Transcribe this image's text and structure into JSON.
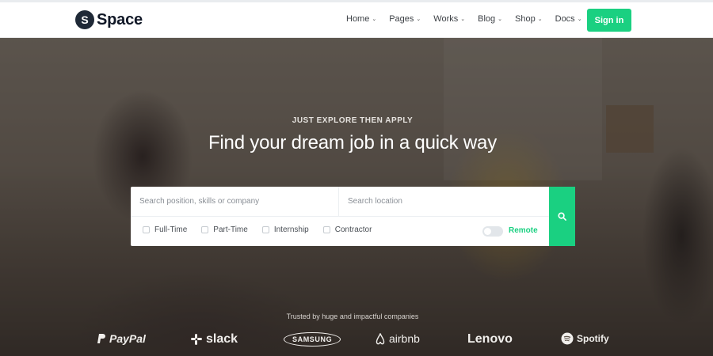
{
  "brand": {
    "mark": "S",
    "name": "Space"
  },
  "nav": {
    "items": [
      {
        "label": "Home"
      },
      {
        "label": "Pages"
      },
      {
        "label": "Works"
      },
      {
        "label": "Blog"
      },
      {
        "label": "Shop"
      },
      {
        "label": "Docs"
      }
    ],
    "caret": "⌄",
    "signin_label": "Sign in"
  },
  "hero": {
    "eyebrow": "JUST EXPLORE THEN APPLY",
    "title": "Find your dream job in a quick way"
  },
  "search": {
    "position_placeholder": "Search position, skills or company",
    "location_placeholder": "Search location",
    "filters": [
      {
        "label": "Full-Time"
      },
      {
        "label": "Part-Time"
      },
      {
        "label": "Internship"
      },
      {
        "label": "Contractor"
      }
    ],
    "remote_label": "Remote",
    "remote_on": false,
    "button_icon": "search-icon"
  },
  "trusted": {
    "text": "Trusted by huge and impactful companies",
    "logos": [
      "PayPal",
      "slack",
      "SAMSUNG",
      "airbnb",
      "Lenovo",
      "Spotify"
    ]
  },
  "colors": {
    "accent": "#1ad081",
    "dark": "#1f2937",
    "text": "#3b3f44"
  }
}
